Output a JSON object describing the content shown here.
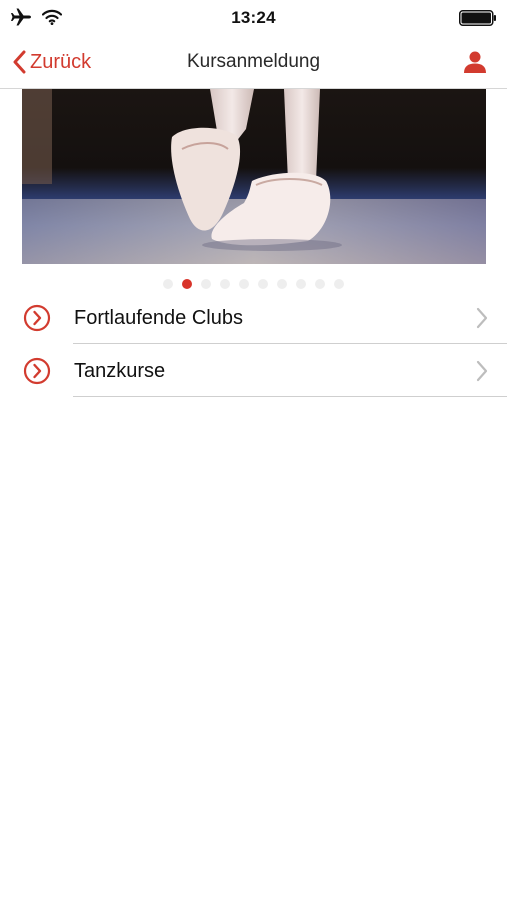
{
  "status_bar": {
    "time": "13:24",
    "icons": [
      "airplane-icon",
      "wifi-icon",
      "battery-icon"
    ]
  },
  "nav": {
    "back_label": "Zurück",
    "title": "Kursanmeldung",
    "profile_icon": "person-icon"
  },
  "carousel": {
    "image": "ballet-pointe-shoes",
    "page_count": 10,
    "active_page": 2
  },
  "list": {
    "items": [
      {
        "label": "Fortlaufende Clubs",
        "icon": "circle-chevron-right-icon"
      },
      {
        "label": "Tanzkurse",
        "icon": "circle-chevron-right-icon"
      }
    ]
  },
  "colors": {
    "accent": "#d23b2f",
    "divider": "#cfcfcf",
    "text": "#111111"
  }
}
